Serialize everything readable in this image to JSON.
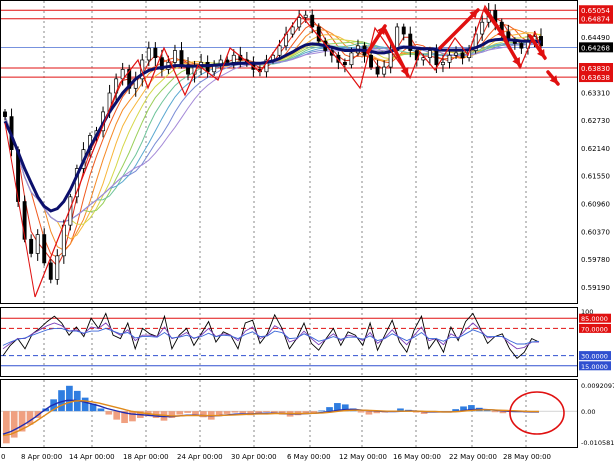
{
  "colors": {
    "background": "#ffffff",
    "frame": "#000000",
    "grid": "#8a8a8a",
    "candle": "#000000",
    "price_line": "#4a6fd4",
    "level_line": "#e01010",
    "level_tag_bg": "#e01010",
    "level_tag_text": "#ffffff",
    "current_tag_bg": "#000000",
    "current_tag_text": "#ffffff",
    "slow_ma": "#0b0f6b",
    "fan": [
      "#dc2b19",
      "#f05a1e",
      "#f58a26",
      "#f7b63a",
      "#d6d84a",
      "#9ad05a",
      "#6fc49a",
      "#5aa8d0",
      "#7a8cd6",
      "#a58ad8"
    ],
    "annotation": "#e01010",
    "rsi_fast": "#000000",
    "rsi_mid": "#7b3fb8",
    "rsi_slow": "#3a66d8",
    "osc_hist_pos": "#2f7de0",
    "osc_hist_neg": "#f0a080",
    "osc_signal_1": "#1f2bb0",
    "osc_signal_2": "#e08a1a",
    "dash_blue": "#3050d0"
  },
  "chart_data": [
    {
      "type": "candlestick",
      "panel": "price",
      "categories": [
        "8 Apr 00:00",
        "14 Apr 00:00",
        "18 Apr 00:00",
        "24 Apr 00:00",
        "30 Apr 00:00",
        "6 May 00:00",
        "12 May 00:00",
        "16 May 00:00",
        "22 May 00:00",
        "28 May 00:00"
      ],
      "x_start_label": "0",
      "ylim": [
        0.5885,
        0.6525
      ],
      "y_ticks": [
        "0.64490",
        "0.63310",
        "0.62730",
        "0.62140",
        "0.61550",
        "0.60960",
        "0.60370",
        "0.59780",
        "0.59190"
      ],
      "levels": [
        {
          "label": "0.65054",
          "value": 0.65054
        },
        {
          "label": "0.64874",
          "value": 0.64874
        },
        {
          "label": "0.63830",
          "value": 0.6383
        },
        {
          "label": "0.63638",
          "value": 0.63638
        }
      ],
      "current_price": {
        "label": "0.64268",
        "value": 0.64268
      },
      "series_close": [
        0.628,
        0.621,
        0.61,
        0.602,
        0.599,
        0.603,
        0.597,
        0.5935,
        0.5985,
        0.605,
        0.611,
        0.617,
        0.621,
        0.624,
        0.625,
        0.629,
        0.633,
        0.636,
        0.638,
        0.634,
        0.636,
        0.64,
        0.6425,
        0.6405,
        0.638,
        0.6395,
        0.642,
        0.639,
        0.637,
        0.6385,
        0.6395,
        0.6375,
        0.639,
        0.64,
        0.6395,
        0.641,
        0.64,
        0.6395,
        0.638,
        0.6375,
        0.64,
        0.641,
        0.643,
        0.6455,
        0.647,
        0.649,
        0.6495,
        0.647,
        0.644,
        0.642,
        0.641,
        0.6395,
        0.639,
        0.6415,
        0.643,
        0.641,
        0.6385,
        0.637,
        0.6385,
        0.642,
        0.647,
        0.6455,
        0.642,
        0.64,
        0.6405,
        0.642,
        0.639,
        0.6395,
        0.641,
        0.6415,
        0.6405,
        0.642,
        0.6455,
        0.648,
        0.6505,
        0.648,
        0.646,
        0.644,
        0.6435,
        0.6425,
        0.644,
        0.645,
        0.643
      ],
      "slow_ma_close": [
        0.627,
        0.624,
        0.6205,
        0.617,
        0.614,
        0.611,
        0.609,
        0.608,
        0.6085,
        0.61,
        0.6125,
        0.6155,
        0.6185,
        0.6215,
        0.624,
        0.6265,
        0.629,
        0.631,
        0.633,
        0.6345,
        0.636,
        0.637,
        0.6378,
        0.6382,
        0.6384,
        0.6386,
        0.6388,
        0.6388,
        0.6387,
        0.6387,
        0.6388,
        0.6388,
        0.6389,
        0.639,
        0.6391,
        0.6392,
        0.6393,
        0.6393,
        0.6393,
        0.6393,
        0.6395,
        0.6398,
        0.6403,
        0.641,
        0.6417,
        0.6425,
        0.6432,
        0.6434,
        0.6433,
        0.643,
        0.6427,
        0.6423,
        0.642,
        0.642,
        0.6421,
        0.642,
        0.6418,
        0.6415,
        0.6415,
        0.6418,
        0.6424,
        0.6427,
        0.6427,
        0.6425,
        0.6424,
        0.6424,
        0.6422,
        0.6421,
        0.6421,
        0.6421,
        0.6421,
        0.6422,
        0.6426,
        0.6432,
        0.644,
        0.6443,
        0.6444,
        0.6443,
        0.6442,
        0.644,
        0.644,
        0.644,
        0.6438
      ]
    },
    {
      "type": "line",
      "panel": "oscillator",
      "ylim": [
        0,
        100
      ],
      "y_ticks": [
        "100",
        "85.0000",
        "70.0000",
        "30.0000",
        "15.0000"
      ],
      "levels": [
        {
          "label": "85.0000",
          "value": 85,
          "style": "solid-red"
        },
        {
          "label": "70.0000",
          "value": 70,
          "style": "dash-red"
        },
        {
          "label": "30.0000",
          "value": 30,
          "style": "dash-blue"
        },
        {
          "label": "15.0000",
          "value": 15,
          "style": "solid-blue"
        }
      ],
      "series": [
        {
          "values": [
            30,
            45,
            55,
            40,
            62,
            70,
            80,
            88,
            78,
            60,
            72,
            58,
            85,
            70,
            92,
            60,
            55,
            78,
            40,
            70,
            62,
            58,
            88,
            40,
            60,
            70,
            45,
            62,
            80,
            50,
            65,
            60,
            40,
            78,
            82,
            48,
            62,
            90,
            70,
            40,
            55,
            78,
            48,
            38,
            55,
            70,
            45,
            65,
            60,
            45,
            78,
            38,
            60,
            82,
            50,
            35,
            68,
            88,
            40,
            55,
            35,
            72,
            52,
            80,
            92,
            70,
            48,
            58,
            62,
            40,
            26,
            35,
            55,
            50
          ]
        },
        {
          "values": [
            40,
            48,
            55,
            55,
            62,
            68,
            74,
            78,
            74,
            66,
            68,
            62,
            72,
            70,
            78,
            66,
            60,
            68,
            52,
            60,
            60,
            58,
            72,
            55,
            58,
            64,
            55,
            60,
            70,
            58,
            62,
            60,
            52,
            66,
            72,
            55,
            60,
            74,
            68,
            50,
            54,
            66,
            55,
            46,
            54,
            62,
            52,
            60,
            58,
            52,
            64,
            48,
            56,
            68,
            56,
            46,
            60,
            72,
            52,
            55,
            46,
            62,
            56,
            68,
            78,
            68,
            56,
            58,
            58,
            48,
            40,
            42,
            50,
            50
          ]
        },
        {
          "values": [
            45,
            50,
            54,
            56,
            60,
            64,
            68,
            70,
            70,
            66,
            66,
            63,
            66,
            66,
            70,
            66,
            62,
            64,
            56,
            58,
            58,
            57,
            64,
            56,
            57,
            60,
            56,
            58,
            63,
            58,
            60,
            59,
            55,
            61,
            65,
            58,
            59,
            66,
            64,
            55,
            56,
            62,
            57,
            51,
            54,
            58,
            54,
            57,
            57,
            54,
            59,
            52,
            55,
            62,
            57,
            52,
            57,
            64,
            55,
            55,
            51,
            57,
            56,
            62,
            68,
            64,
            58,
            58,
            58,
            52,
            47,
            47,
            50,
            51
          ]
        }
      ]
    },
    {
      "type": "bar",
      "panel": "histogram",
      "ylim": [
        -0.010581,
        0.0092097
      ],
      "y_ticks": [
        "0.0092097",
        "0.00",
        "-0.010581"
      ],
      "series": [
        {
          "values": [
            -0.0095,
            -0.0078,
            -0.006,
            -0.004,
            -0.002,
            0.0008,
            0.0035,
            0.0062,
            0.0075,
            0.006,
            0.004,
            0.0022,
            0.0008,
            -0.001,
            -0.0025,
            -0.0035,
            -0.003,
            -0.002,
            -0.0015,
            -0.002,
            -0.0028,
            -0.002,
            -0.001,
            -0.0005,
            -0.001,
            -0.0018,
            -0.0025,
            -0.0015,
            -0.0008,
            -0.0004,
            -0.0006,
            -0.0012,
            -0.0006,
            -0.0002,
            -0.0004,
            -0.001,
            -0.0016,
            -0.0012,
            -0.0008,
            -0.0005,
            0.0002,
            0.0012,
            0.0024,
            0.002,
            0.0008,
            -0.0004,
            -0.001,
            -0.0006,
            -0.0004,
            0.0002,
            0.0008,
            0.0004,
            -0.0004,
            -0.0008,
            -0.0004,
            -0.0001,
            -0.0002,
            0.0006,
            0.0014,
            0.0018,
            0.001,
            0.0003,
            -0.0003,
            -0.0006,
            -0.0002,
            -0.0001,
            -0.0004,
            -0.0002
          ]
        },
        {
          "values": [
            -0.0068,
            -0.006,
            -0.0048,
            -0.0034,
            -0.0018,
            0.0,
            0.0016,
            0.0026,
            0.0032,
            0.0032,
            0.0028,
            0.0022,
            0.0016,
            0.0008,
            0.0002,
            -0.0004,
            -0.0008,
            -0.001,
            -0.0012,
            -0.0014,
            -0.0016,
            -0.0016,
            -0.0014,
            -0.0012,
            -0.0012,
            -0.0013,
            -0.0014,
            -0.0013,
            -0.0011,
            -0.0009,
            -0.0008,
            -0.0008,
            -0.0007,
            -0.0006,
            -0.0006,
            -0.0007,
            -0.0008,
            -0.0008,
            -0.0007,
            -0.0006,
            -0.0004,
            -0.0001,
            0.0003,
            0.0005,
            0.0005,
            0.0003,
            0.0001,
            0.0,
            -0.0001,
            -0.0001,
            0.0,
            0.0001,
            0.0,
            -0.0002,
            -0.0002,
            -0.0002,
            -0.0002,
            0.0,
            0.0003,
            0.0005,
            0.0005,
            0.0004,
            0.0002,
            0.0,
            -0.0001,
            -0.0001,
            -0.0002,
            -0.0002
          ]
        },
        {
          "values": [
            -0.0072,
            -0.0068,
            -0.0058,
            -0.0046,
            -0.0032,
            -0.0016,
            0.0,
            0.0014,
            0.0024,
            0.003,
            0.0031,
            0.0028,
            0.0024,
            0.0018,
            0.0012,
            0.0006,
            0.0,
            -0.0004,
            -0.0007,
            -0.001,
            -0.0012,
            -0.0014,
            -0.0014,
            -0.0013,
            -0.0013,
            -0.0013,
            -0.0013,
            -0.0013,
            -0.0012,
            -0.0011,
            -0.001,
            -0.0009,
            -0.0008,
            -0.0008,
            -0.0007,
            -0.0007,
            -0.0007,
            -0.0007,
            -0.0007,
            -0.0006,
            -0.0005,
            -0.0003,
            0.0,
            0.0002,
            0.0003,
            0.0003,
            0.0002,
            0.0001,
            0.0,
            0.0,
            0.0,
            0.0,
            0.0,
            -0.0001,
            -0.0001,
            -0.0002,
            -0.0002,
            -0.0001,
            0.0001,
            0.0003,
            0.0004,
            0.0004,
            0.0003,
            0.0002,
            0.0001,
            0.0,
            -0.0001,
            -0.0001
          ]
        }
      ]
    }
  ]
}
